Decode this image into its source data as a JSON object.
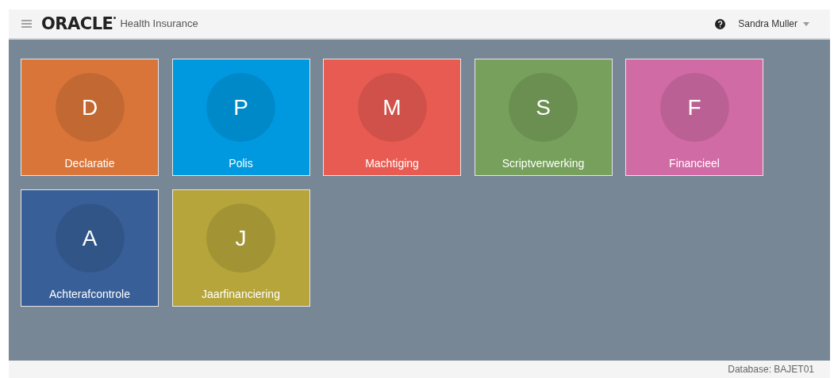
{
  "header": {
    "logo": "ORACLE",
    "product": "Health Insurance",
    "user": "Sandra Muller"
  },
  "tiles": [
    {
      "letter": "D",
      "label": "Declaratie",
      "color": "#d97539"
    },
    {
      "letter": "P",
      "label": "Polis",
      "color": "#0099e0"
    },
    {
      "letter": "M",
      "label": "Machtiging",
      "color": "#e85b52"
    },
    {
      "letter": "S",
      "label": "Scriptverwerking",
      "color": "#76a05b"
    },
    {
      "letter": "F",
      "label": "Financieel",
      "color": "#d16ba5"
    },
    {
      "letter": "A",
      "label": "Achterafcontrole",
      "color": "#385f98"
    },
    {
      "letter": "J",
      "label": "Jaarfinanciering",
      "color": "#b5a53a"
    }
  ],
  "footer": {
    "database": "Database: BAJET01"
  }
}
